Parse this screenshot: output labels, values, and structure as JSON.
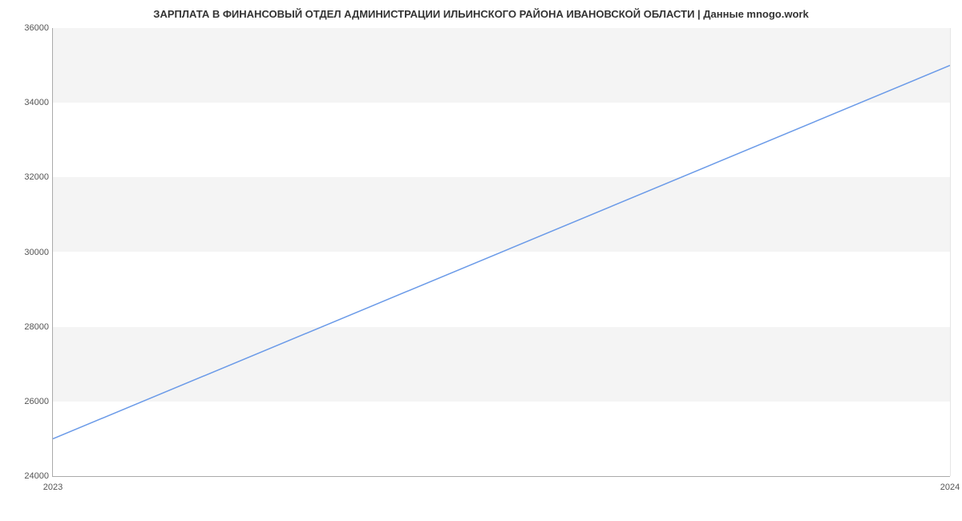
{
  "chart_data": {
    "type": "line",
    "title": "ЗАРПЛАТА В ФИНАНСОВЫЙ ОТДЕЛ АДМИНИСТРАЦИИ ИЛЬИНСКОГО РАЙОНА ИВАНОВСКОЙ ОБЛАСТИ | Данные mnogo.work",
    "x": [
      2023,
      2024
    ],
    "values": [
      25000,
      35000
    ],
    "xlabel": "",
    "ylabel": "",
    "ylim": [
      24000,
      36000
    ],
    "y_ticks": [
      24000,
      26000,
      28000,
      30000,
      32000,
      34000,
      36000
    ],
    "x_ticks": [
      2023,
      2024
    ],
    "line_color": "#6a9ae8"
  }
}
